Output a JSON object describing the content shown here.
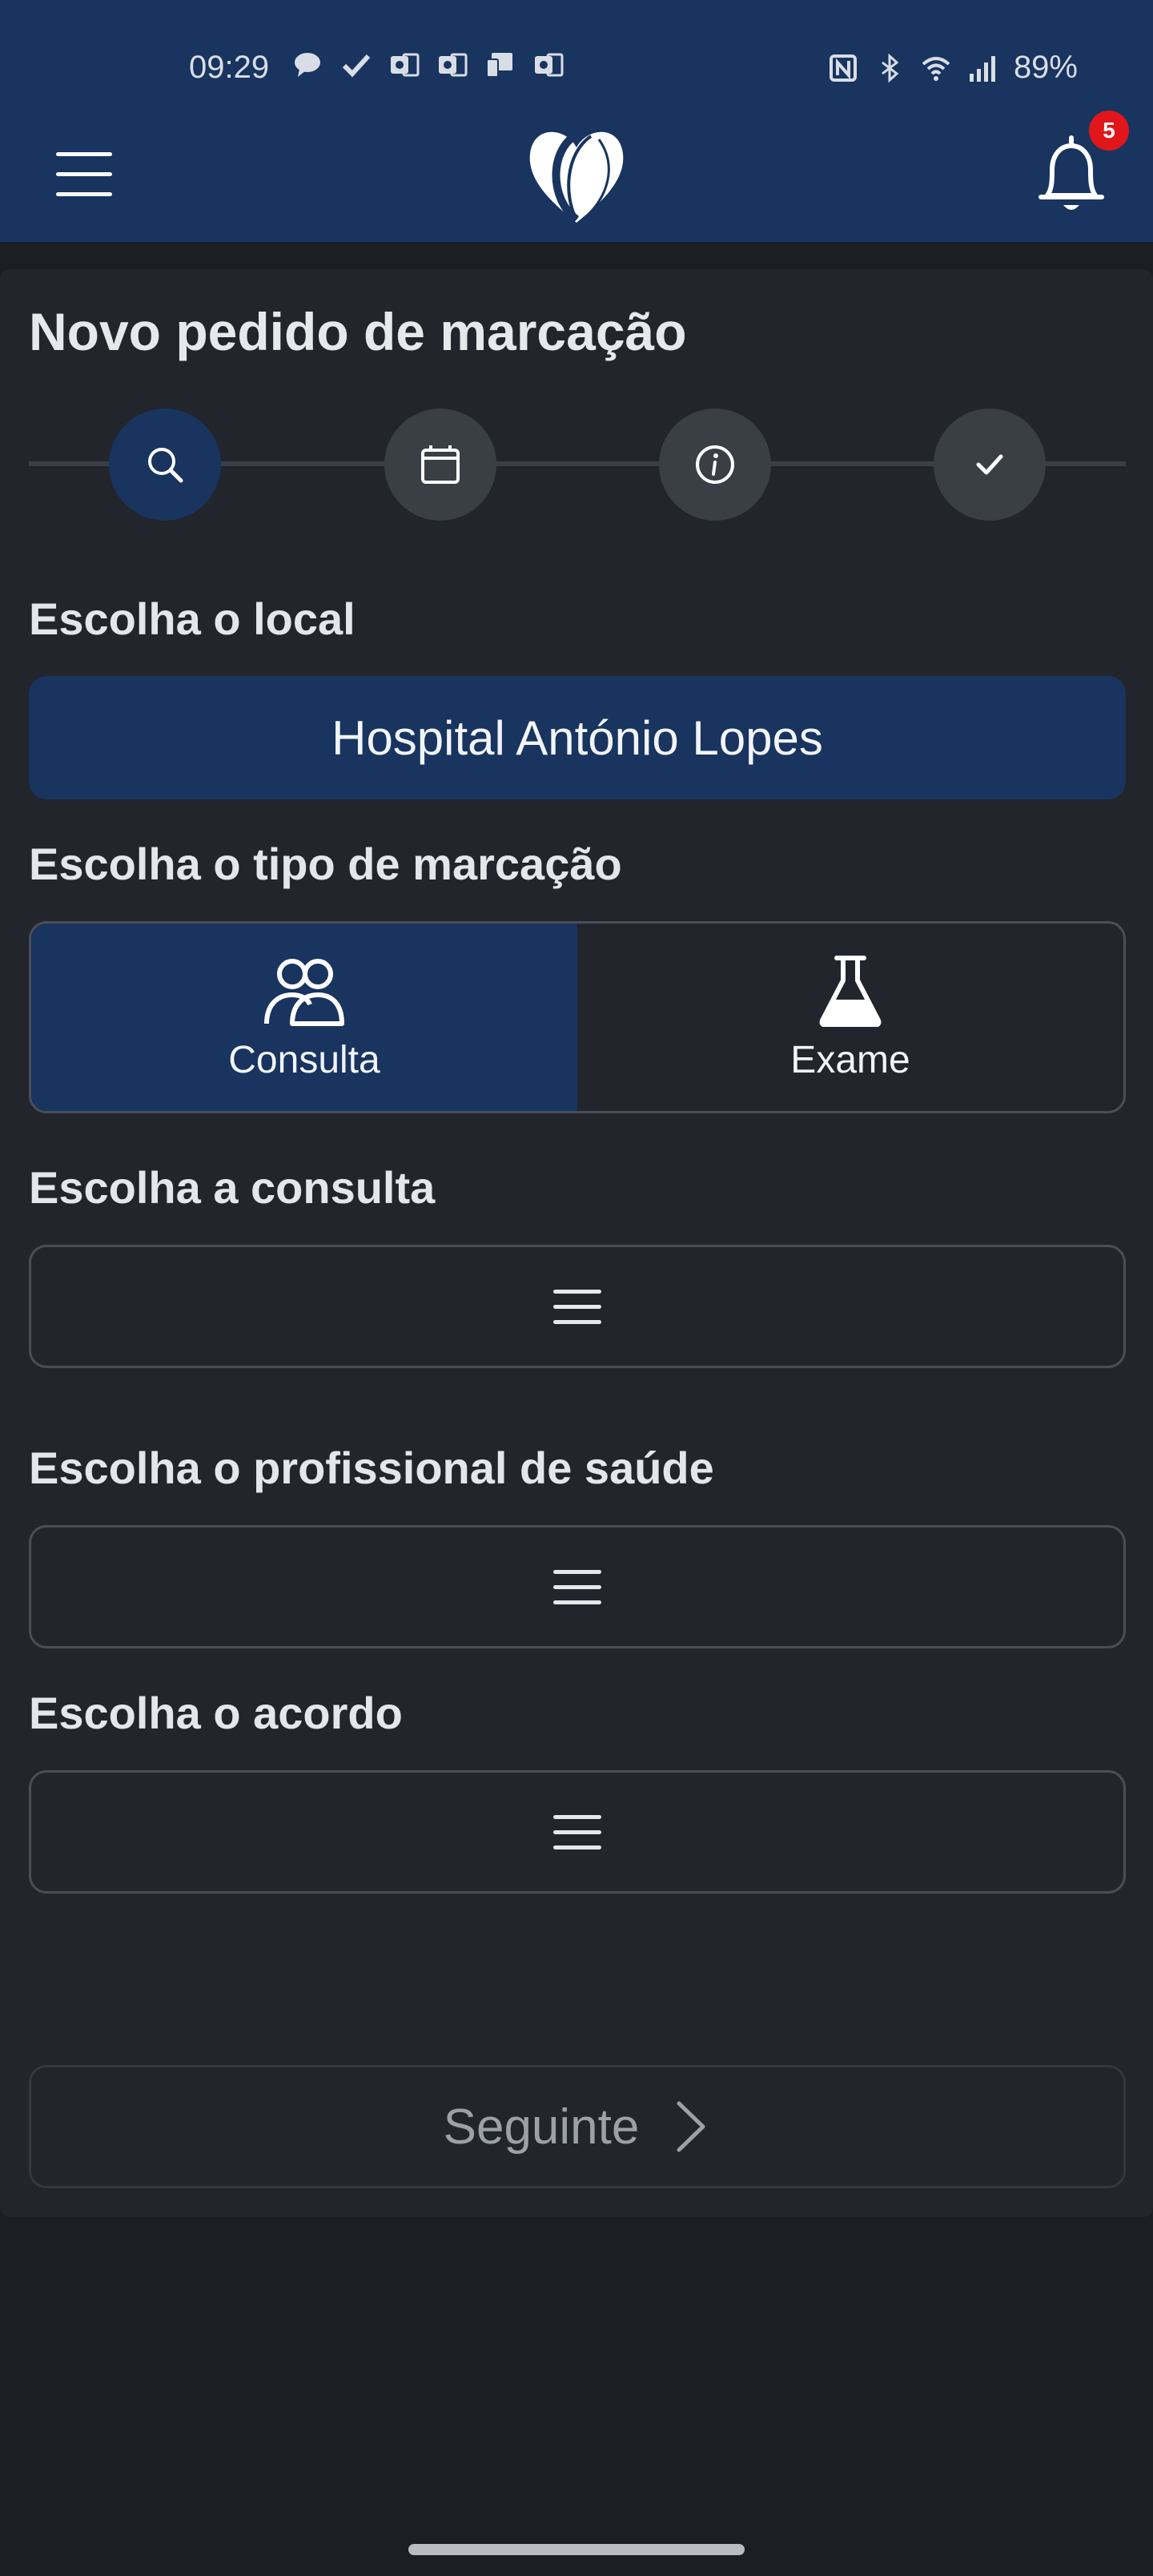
{
  "status_bar": {
    "time": "09:29",
    "battery": "89%",
    "icons": [
      "message-icon",
      "check-icon",
      "outlook-icon",
      "outlook-icon",
      "device-icon",
      "outlook-icon",
      "nfc-icon",
      "bluetooth-icon",
      "wifi-icon",
      "signal-icon"
    ]
  },
  "app_bar": {
    "notification_count": "5"
  },
  "page": {
    "title": "Novo pedido de marcação"
  },
  "stepper": {
    "steps": [
      "search-icon",
      "calendar-icon",
      "info-icon",
      "check-icon"
    ],
    "active_index": 0
  },
  "location": {
    "label": "Escolha o local",
    "value": "Hospital António Lopes"
  },
  "appointment_type": {
    "label": "Escolha o tipo de marcação",
    "options": [
      {
        "label": "Consulta",
        "icon": "people-icon",
        "selected": true
      },
      {
        "label": "Exame",
        "icon": "flask-icon",
        "selected": false
      }
    ]
  },
  "consultation": {
    "label": "Escolha a consulta"
  },
  "professional": {
    "label": "Escolha o profissional de saúde"
  },
  "agreement": {
    "label": "Escolha o acordo"
  },
  "next_button": {
    "label": "Seguinte"
  },
  "colors": {
    "header": "#18345f",
    "background": "#1b1e23",
    "card": "#22252b",
    "accent": "#18345f",
    "badge": "#e0161b"
  }
}
